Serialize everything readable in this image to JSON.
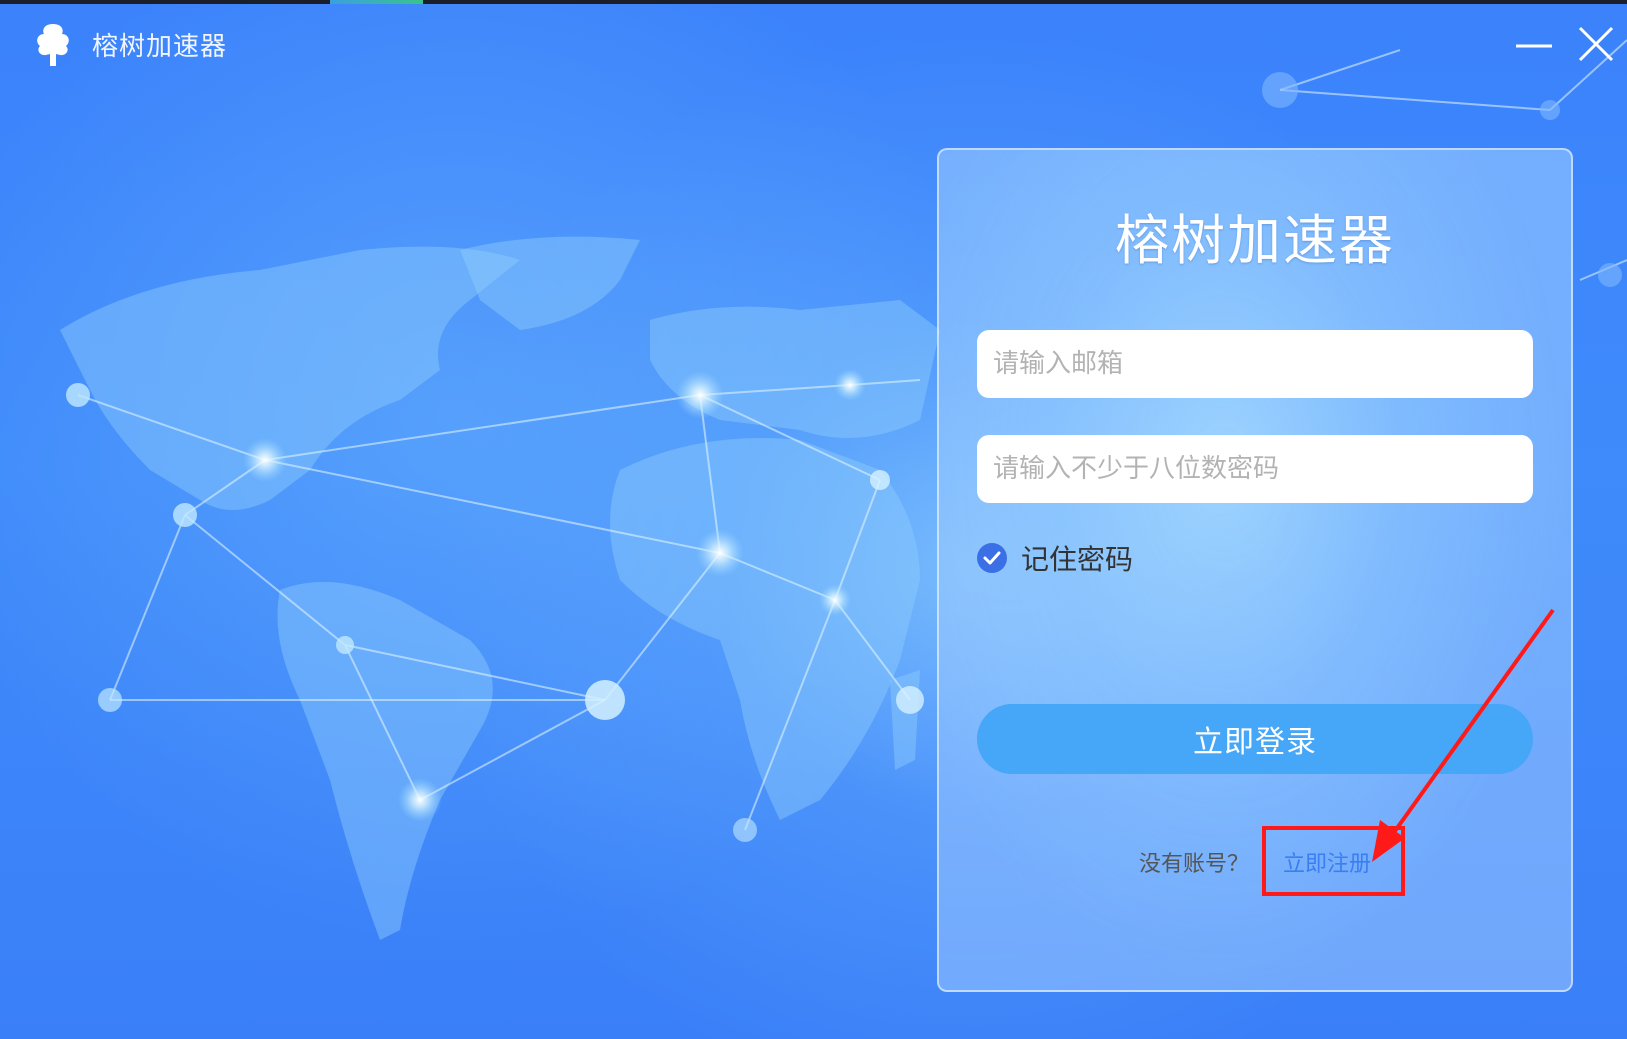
{
  "window": {
    "title": "榕树加速器",
    "minimize_icon": "minimize-icon",
    "close_icon": "close-icon"
  },
  "login": {
    "heading": "榕树加速器",
    "email_placeholder": "请输入邮箱",
    "email_value": "",
    "password_placeholder": "请输入不少于八位数密码",
    "password_value": "",
    "remember_label": "记住密码",
    "remember_checked": true,
    "login_button": "立即登录",
    "no_account_text": "没有账号？",
    "register_link": "立即注册"
  },
  "colors": {
    "background": "#3b82fb",
    "login_button": "#46a6f7",
    "register_link": "#3a7ef2",
    "checkbox": "#3b6fe6",
    "annotation": "#ff1a1a"
  }
}
